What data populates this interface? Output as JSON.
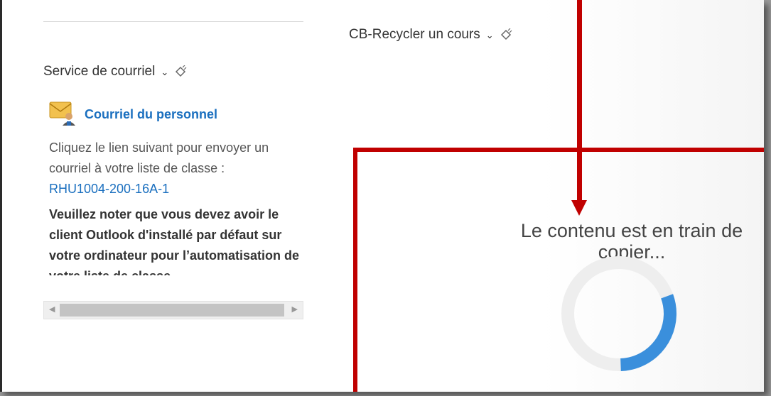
{
  "email_widget": {
    "title": "Service de courriel",
    "link_label": "Courriel du personnel",
    "description": "Cliquez le lien suivant pour envoyer un courriel à votre liste de classe :",
    "class_link": "RHU1004-200-16A-1",
    "note": "Veuillez noter que vous devez avoir le client Outlook d'installé par défaut sur votre ordinateur pour l’automatisation de votre liste de classe."
  },
  "recycle_widget": {
    "title": "CB-Recycler un cours",
    "loading_message": "Le contenu est en train de copier...",
    "progress_fraction": 0.3
  },
  "colors": {
    "link": "#1a6fbf",
    "highlight": "#c00000",
    "spinner_active": "#3a8fdc",
    "spinner_track": "#eeeeee"
  },
  "icons": {
    "chevron": "chevron-down-icon",
    "pin": "pin-icon",
    "mail": "outlook-mail-icon"
  }
}
